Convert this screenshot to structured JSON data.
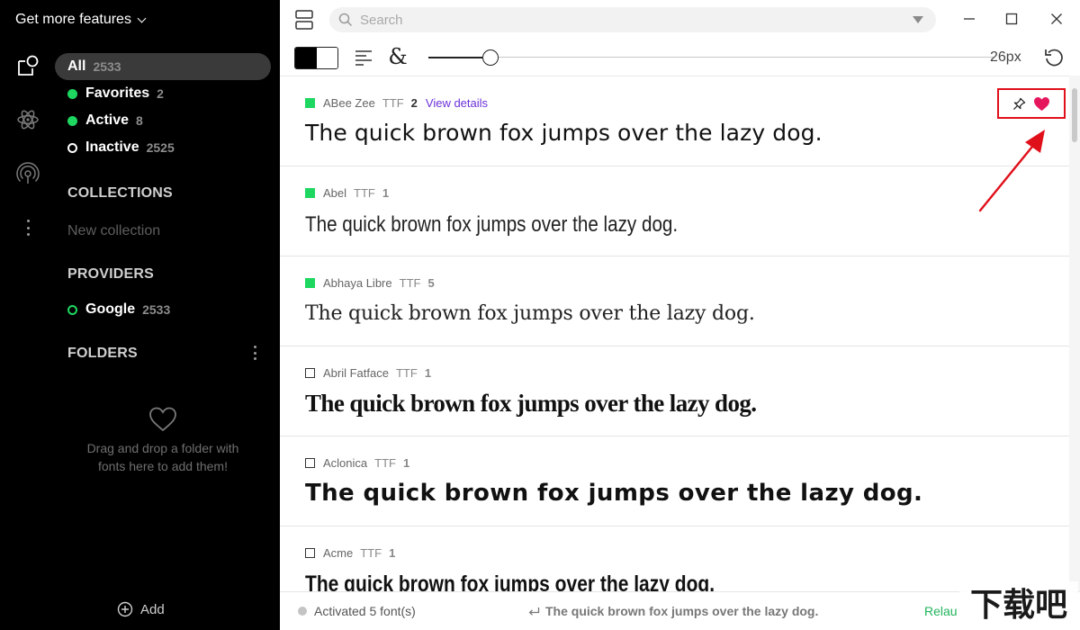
{
  "sidebar": {
    "promo_label": "Get more features",
    "filters": {
      "all": {
        "label": "All",
        "count": "2533"
      },
      "favorites": {
        "label": "Favorites",
        "count": "2"
      },
      "active": {
        "label": "Active",
        "count": "8"
      },
      "inactive": {
        "label": "Inactive",
        "count": "2525"
      }
    },
    "collections_title": "COLLECTIONS",
    "new_collection_label": "New collection",
    "providers_title": "PROVIDERS",
    "providers": [
      {
        "label": "Google",
        "count": "2533"
      }
    ],
    "folders_title": "FOLDERS",
    "folders_hint": "Drag and drop a folder with fonts here to add them!",
    "add_label": "Add"
  },
  "toolbar": {
    "search_placeholder": "Search",
    "size_value": "26px",
    "size_fraction": 0.11,
    "glyph_symbol": "&"
  },
  "fonts": [
    {
      "name": "ABee Zee",
      "format": "TTF",
      "count": "2",
      "details_label": "View details",
      "active": true,
      "sample": "The quick brown fox jumps over the lazy dog."
    },
    {
      "name": "Abel",
      "format": "TTF",
      "count": "1",
      "active": true,
      "sample": "The quick brown fox jumps over the lazy dog."
    },
    {
      "name": "Abhaya Libre",
      "format": "TTF",
      "count": "5",
      "active": true,
      "sample": "The quick brown fox jumps over the lazy dog."
    },
    {
      "name": "Abril Fatface",
      "format": "TTF",
      "count": "1",
      "active": false,
      "sample": "The quick brown fox jumps over the lazy dog."
    },
    {
      "name": "Aclonica",
      "format": "TTF",
      "count": "1",
      "active": false,
      "sample": "The quick brown fox jumps over the lazy dog."
    },
    {
      "name": "Acme",
      "format": "TTF",
      "count": "1",
      "active": false,
      "sample": "The quick brown fox jumps over the lazy dog."
    }
  ],
  "status": {
    "activated_text": "Activated 5 font(s)",
    "preview_text": "The quick brown fox jumps over the lazy dog.",
    "relaunch_label": "Relau"
  },
  "watermark_text": "下载吧",
  "colors": {
    "accent_green": "#1ed760",
    "link_purple": "#6b31d9",
    "favorite_pink": "#e6165c",
    "annotation_red": "#e0101b"
  }
}
